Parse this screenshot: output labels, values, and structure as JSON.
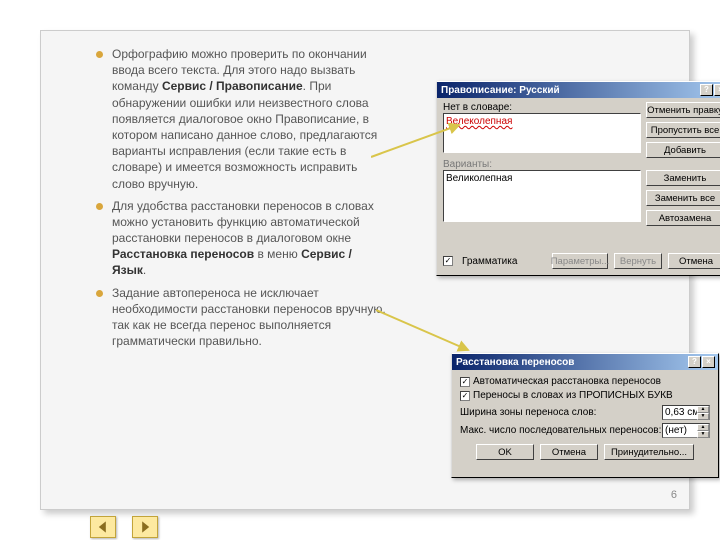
{
  "page_number": "6",
  "bullets": [
    {
      "pre": "Орфографию можно проверить по окончании ввода всего текста. Для этого надо вызвать команду ",
      "b": "Сервис / Правописание",
      "post": ". При обнаружении ошибки или неизвестного слова появляется диалоговое окно Правописание, в котором написано данное слово, предлагаются варианты исправления (если такие есть в словаре) и имеется возможность исправить слово вручную."
    },
    {
      "pre": "Для удобства расстановки переносов в словах можно установить функцию автоматической расстановки переносов в диалоговом окне ",
      "b": "Расстановка переносов",
      "post": " в меню "
    },
    {
      "pre": "Задание автопереноса не исключает необходимости расстановки переносов вручную, так как не всегда перенос выполняется грамматически правильно.",
      "b": "",
      "post": ""
    }
  ],
  "bullet2_extra": {
    "b": "Сервис / Язык",
    "post": "."
  },
  "dlg1": {
    "title": "Правописание: Русский",
    "not_in_dict_label": "Нет в словаре:",
    "not_in_dict_value": "Велеколепная",
    "variants_label": "Варианты:",
    "variants_value": "Великолепная",
    "grammar_label": "Грамматика",
    "buttons": {
      "skip": "Отменить правку",
      "skip_all": "Пропустить все",
      "add": "Добавить",
      "replace": "Заменить",
      "replace_all": "Заменить все",
      "auto": "Автозамена",
      "options": "Параметры...",
      "undo": "Вернуть",
      "cancel": "Отмена"
    }
  },
  "dlg2": {
    "title": "Расстановка переносов",
    "auto_label": "Автоматическая расстановка переносов",
    "caps_label": "Переносы в словах из ПРОПИСНЫХ БУКВ",
    "zone_label": "Ширина зоны переноса слов:",
    "zone_value": "0,63 см",
    "max_label": "Макс. число последовательных переносов:",
    "max_value": "(нет)",
    "ok": "OK",
    "cancel": "Отмена",
    "force": "Принудительно..."
  },
  "sysbuttons": {
    "help": "?",
    "close": "×"
  }
}
